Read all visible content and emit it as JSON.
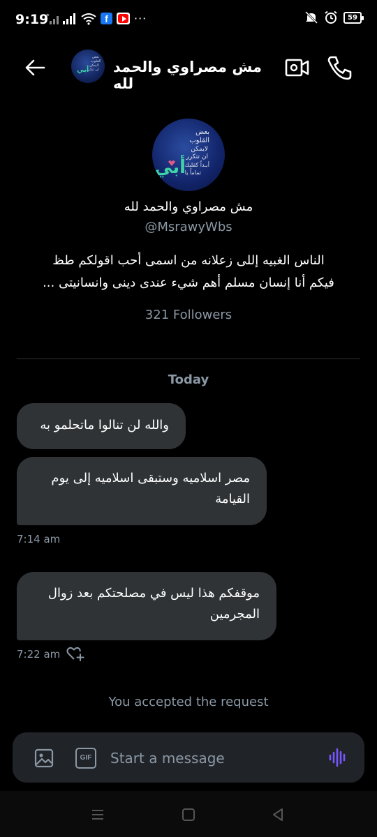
{
  "status": {
    "time": "9:19",
    "battery": "59",
    "more": "···"
  },
  "header": {
    "name": "مش مصراوي والحمد لله"
  },
  "profile": {
    "name": "مش مصراوي والحمد لله",
    "handle": "@MsrawyWbs",
    "bio_line1": "الناس الغبيه إللى زعلانه من اسمى أحب اقولكم طظ",
    "bio_line2": "فيكم أنا إنسان مسلم أهم شيء عندى دينى وانسانيتى ...",
    "followers": "321 Followers",
    "avatar_text_lines": [
      "بعض",
      "القلوب",
      "لايمكن",
      "ان تتكرر",
      "أبـداً كقلبك",
      "تماماً يا"
    ],
    "avatar_big": "أبي"
  },
  "conversation": {
    "date_label": "Today",
    "messages": [
      {
        "text": "والله لن تنالوا ماتحلمو به"
      },
      {
        "text": "مصر اسلاميه وستبقى اسلاميه إلى يوم القيامة",
        "time": "7:14 am"
      },
      {
        "text": "موقفكم هذا ليس في مصلحتكم بعد زوال المجرمين",
        "time": "7:22 am"
      }
    ],
    "system_note": "You accepted the request"
  },
  "composer": {
    "placeholder": "Start a message",
    "gif_label": "GIF"
  },
  "colors": {
    "background": "#000000",
    "bubble": "#2f3336",
    "muted": "#8b98a5",
    "voice_accent": "#7856ff"
  }
}
